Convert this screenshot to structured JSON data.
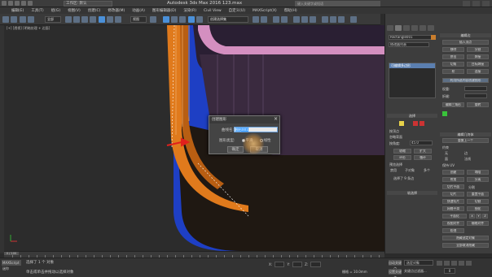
{
  "app": {
    "title": "Autodesk 3ds Max 2016    123.max",
    "workspace": "工作区: 默认",
    "search_placeholder": "键入关键字或短语"
  },
  "menu": [
    "编辑(E)",
    "工具(T)",
    "组(G)",
    "视图(V)",
    "创建(C)",
    "修改器(M)",
    "动画(A)",
    "图形编辑器(D)",
    "渲染(R)",
    "Civil View",
    "自定义(U)",
    "MAXScript(X)",
    "帮助(H)"
  ],
  "toolbar": {
    "filter_value": "全部",
    "view_value": "视图",
    "selset_value": "创建选择集"
  },
  "viewport": {
    "label": "[+] [透视] [明暗处理 + 边面]"
  },
  "dialog": {
    "title": "创建图形",
    "name_label": "曲线名:",
    "name_value": "图形001",
    "type_label": "图形类型:",
    "opt_smooth": "平滑",
    "opt_linear": "线性",
    "ok": "确定",
    "cancel": "取消"
  },
  "panel": {
    "obj_name": "Rectangle001",
    "modifier_list_label": "修改器列表",
    "stack_item": "可编辑多边形",
    "sel_title": "选择",
    "by_vertex": "按顶点",
    "ignore_back": "忽略背面",
    "by_angle": "按角度:",
    "angle_value": "45.0",
    "shrink": "收缩",
    "grow": "扩大",
    "ring": "环形",
    "loop": "循环",
    "preview_sel": "预览选择",
    "off": "禁用",
    "sub_obj": "子对象",
    "multi": "多个",
    "status": "选择了 9 条边",
    "soft_sel": "软选择",
    "edit_edges_hdr": "编辑边",
    "insert_vertex": "插入顶点",
    "remove": "移除",
    "split": "分割",
    "extrude": "挤出",
    "weld": "焊接",
    "chamfer": "切角",
    "target_weld": "目标焊接",
    "bridge": "桥",
    "connect": "连接",
    "create_shape": "利用所选内容创建图形",
    "weight_label": "权重:",
    "crease_label": "折缝:",
    "edit_tri": "编辑三角形",
    "rotate": "旋转",
    "edit_geo_hdr": "编辑几何体",
    "repeat_last": "重复上一个",
    "constraints": "约束",
    "none": "无",
    "edge": "边",
    "face": "面",
    "normal": "法线",
    "preserve_uv": "保持 UV",
    "create": "创建",
    "collapse": "塌陷",
    "attach": "附加",
    "detach": "分离",
    "slice_plane": "切片平面",
    "split_cb": "分割",
    "slice": "切片",
    "reset_plane": "重置平面",
    "quickslice": "快速切片",
    "cut": "切割",
    "meshsmooth": "网格平滑",
    "tessellate": "细化",
    "make_planar": "平面化",
    "xyz": [
      "X",
      "Y",
      "Z"
    ],
    "view_align": "视图对齐",
    "grid_align": "栅格对齐",
    "relax": "松弛",
    "hide_sel": "隐藏选定对象",
    "unhide_all": "全部取消隐藏",
    "hide_unsel": "隐藏未选定对象",
    "named_sel": "命名选择:",
    "copy": "复制",
    "paste": "粘贴",
    "delete_iso": "删除孤立顶点",
    "full_interact": "完全交互",
    "sub_division": "细分曲面"
  },
  "timeline": {
    "slider_label": "0 / 100"
  },
  "status": {
    "listener": "MAXScript 迷你",
    "line1": "选择了 1 个 对象",
    "line2": "单击或单击并拖动以选择对象",
    "x": "X:",
    "y": "Y:",
    "z": "Z:",
    "grid": "栅格 = 10.0mm",
    "add_time_tag": "添加时间标记",
    "autokey": "自动关键点",
    "sel_obj": "选定对象",
    "setkey": "设置关键点",
    "key_filters": "关键点过滤器...",
    "frame": "0"
  }
}
